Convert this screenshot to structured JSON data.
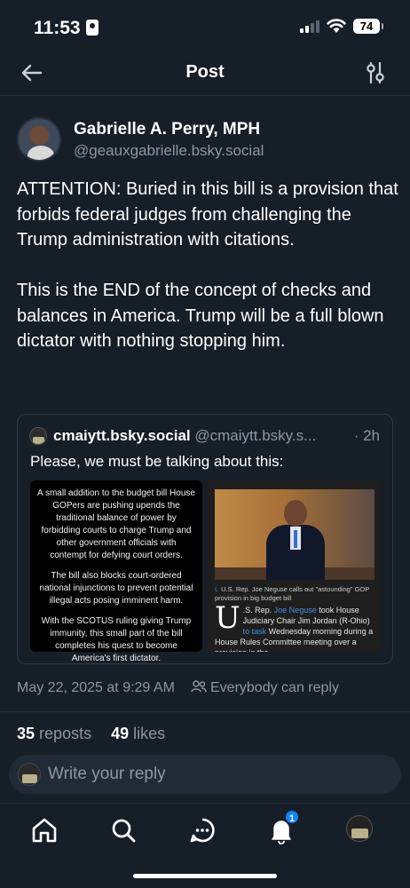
{
  "status_bar": {
    "time": "11:53",
    "battery": "74"
  },
  "header": {
    "title": "Post"
  },
  "author": {
    "name": "Gabrielle A. Perry, MPH",
    "handle": "@geauxgabrielle.bsky.social"
  },
  "post": {
    "text": "ATTENTION: Buried in this bill is a provision that forbids federal judges from challenging the Trump administration with citations.\n\nThis is the END of the concept of checks and balances in America. Trump will be a full blown dictator with nothing stopping him.",
    "date": "May 22, 2025 at 9:29 AM",
    "reply_setting": "Everybody can reply",
    "reposts_count": "35",
    "reposts_label": "reposts",
    "likes_count": "49",
    "likes_label": "likes"
  },
  "quote": {
    "name": "cmaiytt.bsky.social",
    "handle": "@cmaiytt.bsky.s...",
    "time": "· 2h",
    "text": "Please, we must be talking about this:",
    "image_left": {
      "para1": "A small addition to the budget bill House GOPers are pushing upends the traditional balance of power by forbidding courts to charge Trump and other government officials with contempt for defying court orders.",
      "para2": "The bill also blocks court-ordered national injunctions to prevent potential illegal acts posing imminent harm.",
      "para3": "With the SCOTUS ruling giving Trump immunity, this small part of the bill completes his quest to become America's first dictator."
    },
    "image_right": {
      "caption_mark": "L",
      "caption": "U.S. Rep. Joe Neguse calls out \"astounding\" GOP provision in big budget bill",
      "dropcap": "U",
      "article_1": ".S. Rep. ",
      "article_link1": "Joe Neguse",
      "article_2": " took House Judiciary Chair Jim Jordan (R-Ohio) ",
      "article_link2": "to task",
      "article_3": " Wednesday morning during a House Rules Committee meeting over a provision in the"
    }
  },
  "reply": {
    "placeholder": "Write your reply"
  },
  "tabbar": {
    "notifications_badge": "1"
  }
}
